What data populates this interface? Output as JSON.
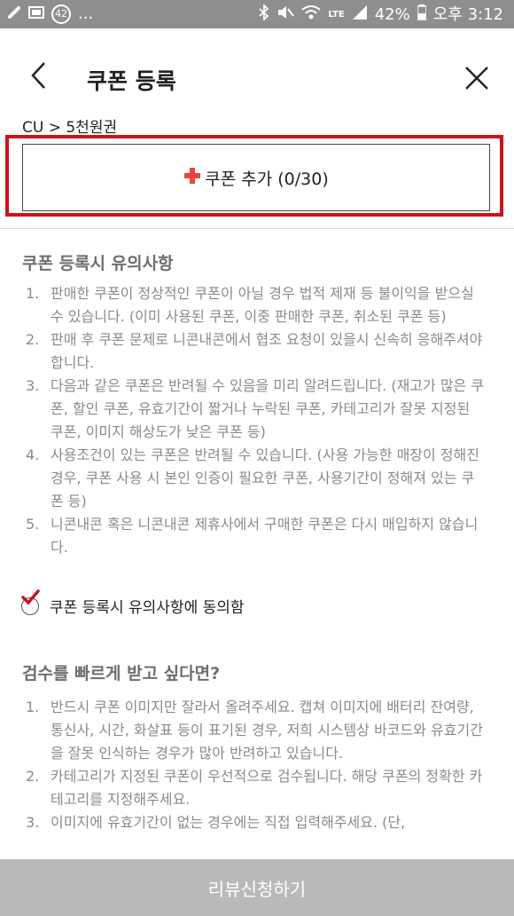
{
  "status_bar": {
    "notification_count": "42",
    "dots": "...",
    "lte": "LTE",
    "battery": "42%",
    "time": "오후 3:12"
  },
  "header": {
    "title": "쿠폰 등록"
  },
  "breadcrumb": "CU > 5천원권",
  "add_button": {
    "label": "쿠폰 추가 (0/30)"
  },
  "notice": {
    "title": "쿠폰 등록시 유의사항",
    "items": [
      {
        "num": "1.",
        "text": "판매한 쿠폰이 정상적인 쿠폰이 아닐 경우 법적 제재 등 불이익을 받으실 수 있습니다. (이미 사용된 쿠폰, 이중 판매한 쿠폰, 취소된 쿠폰 등)"
      },
      {
        "num": "2.",
        "text": "판매 후 쿠폰 문제로 니콘내콘에서 협조 요청이 있을시 신속히 응해주셔야 합니다."
      },
      {
        "num": "3.",
        "text": "다음과 같은 쿠폰은 반려될 수 있음을 미리 알려드립니다. (재고가 많은 쿠폰, 할인 쿠폰, 유효기간이 짧거나 누락된 쿠폰, 카테고리가 잘못 지정된 쿠폰, 이미지 해상도가 낮은 쿠폰 등)"
      },
      {
        "num": "4.",
        "text": "사용조건이 있는 쿠폰은 반려될 수 있습니다. (사용 가능한 매장이 정해진 경우, 쿠폰 사용 시 본인 인증이 필요한 쿠폰, 사용기간이 정해져 있는 쿠폰 등)"
      },
      {
        "num": "5.",
        "text": "니콘내콘 혹은 니콘내콘 제휴사에서 구매한 쿠폰은 다시 매입하지 않습니다."
      }
    ]
  },
  "agree": {
    "label": "쿠폰 등록시 유의사항에 동의함",
    "checked": true
  },
  "tips": {
    "title": "검수를 빠르게 받고 싶다면?",
    "items": [
      {
        "num": "1.",
        "text": "반드시 쿠폰 이미지만 잘라서 올려주세요. 캡쳐 이미지에 배터리 잔여량, 통신사, 시간, 화살표 등이 표기된 경우, 저희 시스템상 바코드와 유효기간을 잘못 인식하는 경우가 많아 반려하고 있습니다."
      },
      {
        "num": "2.",
        "text": "카테고리가 지정된 쿠폰이 우선적으로 검수됩니다. 해당 쿠폰의 정확한 카테고리를 지정해주세요."
      },
      {
        "num": "3.",
        "text": "이미지에 유효기간이 없는 경우에는 직접 입력해주세요. (단,"
      }
    ]
  },
  "submit_button": {
    "label": "리뷰신청하기"
  },
  "colors": {
    "highlight": "#d0121b",
    "plus": "#e8453c",
    "submit_bg": "#b9b9b9"
  }
}
